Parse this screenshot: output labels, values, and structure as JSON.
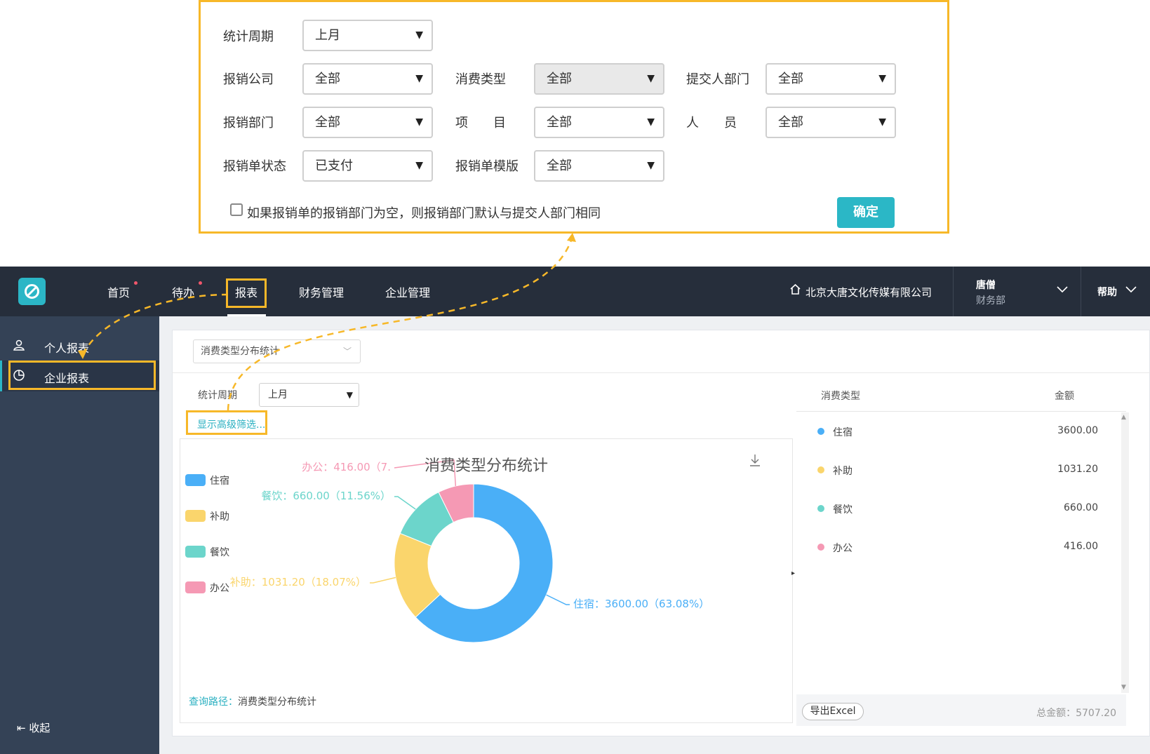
{
  "filter_panel": {
    "period_label": "统计周期",
    "period_value": "上月",
    "company_label": "报销公司",
    "company_value": "全部",
    "expense_type_label": "消费类型",
    "expense_type_value": "全部",
    "submitter_dept_label": "提交人部门",
    "submitter_dept_value": "全部",
    "reimb_dept_label": "报销部门",
    "reimb_dept_value": "全部",
    "project_label": "项　　目",
    "project_value": "全部",
    "person_label": "人　　员",
    "person_value": "全部",
    "status_label": "报销单状态",
    "status_value": "已支付",
    "template_label": "报销单模版",
    "template_value": "全部",
    "checkbox_hint": "如果报销单的报销部门为空，则报销部门默认与提交人部门相同",
    "confirm_label": "确定",
    "arrow_icon": "▼"
  },
  "topbar": {
    "nav": [
      "首页",
      "待办",
      "报表",
      "财务管理",
      "企业管理"
    ],
    "company": "北京大唐文化传媒有限公司",
    "user_name": "唐僧",
    "user_dept": "财务部",
    "help": "帮助"
  },
  "sidebar": {
    "items": [
      "个人报表",
      "企业报表"
    ],
    "collapse": "收起"
  },
  "main": {
    "report_select": "消费类型分布统计",
    "period_label": "统计周期",
    "period_value": "上月",
    "advanced_link": "显示高级筛选...",
    "query_path_label": "查询路径：",
    "query_path_value": "消费类型分布统计"
  },
  "table": {
    "col_type": "消费类型",
    "col_amount": "金额",
    "rows": [
      {
        "name": "住宿",
        "amount": "3600.00"
      },
      {
        "name": "补助",
        "amount": "1031.20"
      },
      {
        "name": "餐饮",
        "amount": "660.00"
      },
      {
        "name": "办公",
        "amount": "416.00"
      }
    ],
    "export_label": "导出Excel",
    "total": "总金额：5707.20"
  },
  "colors": {
    "accent": "#2bb6c6",
    "highlight": "#f7b829",
    "住宿": "#4aaff7",
    "补助": "#fad56c",
    "餐饮": "#6cd5cb",
    "办公": "#f599b4"
  },
  "chart_data": {
    "type": "pie",
    "title": "消费类型分布统计",
    "categories": [
      "住宿",
      "补助",
      "餐饮",
      "办公"
    ],
    "values": [
      3600.0,
      1031.2,
      660.0,
      416.0
    ],
    "percent": [
      63.08,
      18.07,
      11.56,
      7.29
    ],
    "labels": [
      "住宿：3600.00（63.08%）",
      "补助：1031.20（18.07%）",
      "餐饮：660.00（11.56%）",
      "办公：416.00（7."
    ],
    "colors": [
      "#4aaff7",
      "#fad56c",
      "#6cd5cb",
      "#f599b4"
    ],
    "legend_position": "left"
  }
}
